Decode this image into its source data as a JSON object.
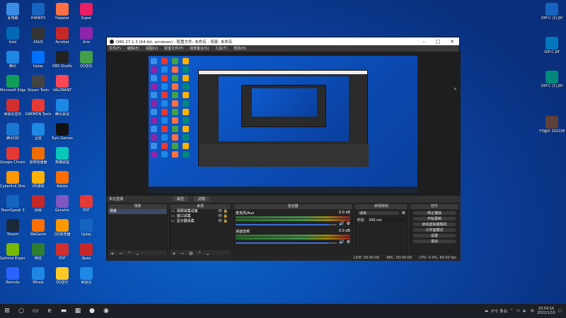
{
  "desktop_left": [
    {
      "label": "此电脑",
      "color": "#3a8ee6"
    },
    {
      "label": "Intel",
      "color": "#0068b5"
    },
    {
      "label": "腾讯",
      "color": "#1e88e5"
    },
    {
      "label": "Microsoft Edge",
      "color": "#0f9d58"
    },
    {
      "label": "网易云音乐",
      "color": "#d32f2f"
    },
    {
      "label": "腾讯QQ",
      "color": "#1976d2"
    },
    {
      "label": "Google Chrome",
      "color": "#e53935"
    },
    {
      "label": "Cyberlink Director",
      "color": "#ff9800"
    },
    {
      "label": "TeamSpeak 3",
      "color": "#1565c0"
    },
    {
      "label": "Steam",
      "color": "#1b2838"
    },
    {
      "label": "Geforce Experience",
      "color": "#76b900"
    },
    {
      "label": "Remote",
      "color": "#2962ff"
    }
  ],
  "desktop_col2": [
    {
      "label": "HWiNFO",
      "color": "#1565c0"
    },
    {
      "label": "ASUS",
      "color": "#333333"
    },
    {
      "label": "Uplay",
      "color": "#0070ff"
    },
    {
      "label": "Steam Tools",
      "color": "#444444"
    },
    {
      "label": "DAEMON Tools",
      "color": "#e53935"
    },
    {
      "label": "迅雷",
      "color": "#1e88e5"
    },
    {
      "label": "雷神加速器",
      "color": "#ef6c00"
    },
    {
      "label": "VR游戏",
      "color": "#ffb300"
    },
    {
      "label": "网易",
      "color": "#c62828"
    },
    {
      "label": "WeGame",
      "color": "#ff6f00"
    },
    {
      "label": "微信",
      "color": "#2e7d32"
    },
    {
      "label": "Whale",
      "color": "#1e88e5"
    }
  ],
  "desktop_col3": [
    {
      "label": "Happier",
      "color": "#ff7043"
    },
    {
      "label": "Acrobat",
      "color": "#c62828"
    },
    {
      "label": "OBS Studio",
      "color": "#222222"
    },
    {
      "label": "VALORANT",
      "color": "#ff4655"
    },
    {
      "label": "腾讯会议",
      "color": "#1e88e5"
    },
    {
      "label": "Epic Games",
      "color": "#111111"
    },
    {
      "label": "英雄联盟",
      "color": "#0ac8b9"
    },
    {
      "label": "Adobe",
      "color": "#ff6d00"
    },
    {
      "label": "Genshin",
      "color": "#7e57c2"
    },
    {
      "label": "QQ浏览器",
      "color": "#ff9800"
    },
    {
      "label": "PDF",
      "color": "#d32f2f"
    },
    {
      "label": "QQ音乐",
      "color": "#ffca28"
    }
  ],
  "desktop_col4": [
    {
      "label": "Super",
      "color": "#e91e63"
    },
    {
      "label": "Aria",
      "color": "#8e24aa"
    },
    {
      "label": "QQ音乐",
      "color": "#43a047"
    },
    {
      "label": "PDF",
      "color": "#e53935"
    },
    {
      "label": "Uplay",
      "color": "#1565c0"
    },
    {
      "label": "Apex",
      "color": "#c62828"
    },
    {
      "label": "网易云",
      "color": "#1e88e5"
    }
  ],
  "desktop_right": [
    {
      "label": "OIP-C (2).jfif",
      "color": "#1565c0"
    },
    {
      "label": "OIP-C.jfif",
      "color": "#0277bd"
    },
    {
      "label": "OIP-C (1).jfif",
      "color": "#00897b"
    },
    {
      "label": "YY图片 20210831...",
      "color": "#5d4037"
    }
  ],
  "obs": {
    "title": "OBS 27.1.3 (64-bit, windows) - 配置文件: 未命名 - 场景: 未命名",
    "menu": [
      "文件(F)",
      "编辑(E)",
      "视图(V)",
      "配置文件(P)",
      "场景集合(S)",
      "工具(T)",
      "帮助(H)"
    ],
    "not_live": "未在直播",
    "btn_props": "属性",
    "btn_filters": "滤镜",
    "scenes_header": "场景",
    "scenes": [
      "场景"
    ],
    "sources_header": "来源",
    "sources": [
      "视频采集设备",
      "窗口采集",
      "显示器采集"
    ],
    "mixer_header": "混音器",
    "mixer": [
      {
        "name": "麦克风/Aux",
        "db": "0.0 dB"
      },
      {
        "name": "桌面音频",
        "db": "0.0 dB"
      }
    ],
    "transitions_header": "转场特效",
    "transition_type": "淡出",
    "duration_label": "时长",
    "duration_value": "300 ms",
    "controls_header": "控件",
    "controls": [
      "停止播流",
      "开始录制",
      "启动虚拟摄像机",
      "工作室模式",
      "设置",
      "退出"
    ],
    "status": {
      "live": "LIVE: 00:00:00",
      "rec": "REC: 00:00:00",
      "cpu": "CPU: 0.9%, 60.00 fps"
    }
  },
  "taskbar": {
    "icons": [
      "windows-icon",
      "search-icon",
      "taskview-icon",
      "edge-icon",
      "explorer-icon",
      "store-icon",
      "obs-icon",
      "steam-icon"
    ],
    "weather": "0°C 多云",
    "time": "20:54:16",
    "date": "2022/1/10"
  }
}
